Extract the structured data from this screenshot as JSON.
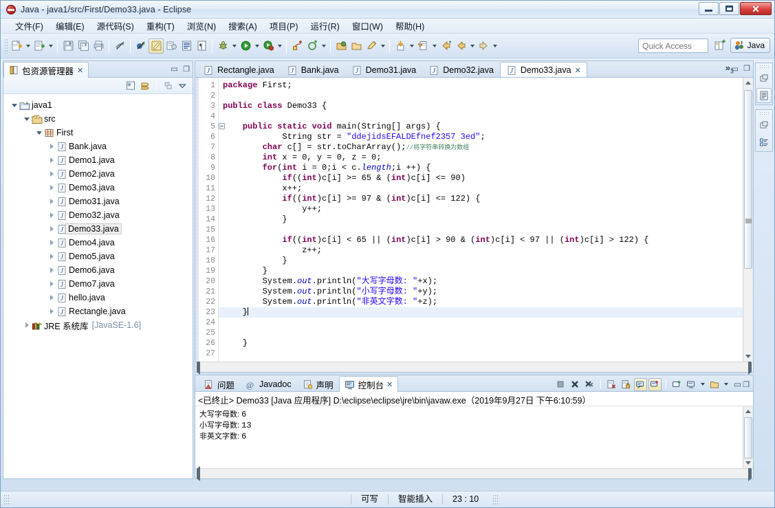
{
  "window": {
    "title": "Java  -  java1/src/First/Demo33.java  -  Eclipse",
    "minimize_label": "Minimize",
    "maximize_label": "Maximize",
    "close_label": "Close"
  },
  "menubar": [
    {
      "label": "文件(F)"
    },
    {
      "label": "编辑(E)"
    },
    {
      "label": "源代码(S)"
    },
    {
      "label": "重构(T)"
    },
    {
      "label": "浏览(N)"
    },
    {
      "label": "搜索(A)"
    },
    {
      "label": "项目(P)"
    },
    {
      "label": "运行(R)"
    },
    {
      "label": "窗口(W)"
    },
    {
      "label": "帮助(H)"
    }
  ],
  "toolbar": {
    "quick_access_placeholder": "Quick Access",
    "perspective_label": "Java",
    "icons": [
      "new-java-project-icon",
      "new-wizard-icon",
      "save-icon",
      "save-all-icon",
      "print-icon",
      "toggle-mark-occurrences-icon",
      "skip-breakpoints-icon",
      "new-java-class-icon",
      "open-type-icon",
      "external-tools-icon",
      "debug-icon",
      "run-icon",
      "run-last-tool-icon",
      "new-annotation-icon",
      "next-annotation-icon",
      "open-task-icon",
      "search-icon",
      "edit-icon",
      "last-edit-location-icon",
      "open-declaration-icon",
      "back-icon",
      "previous-edit-icon",
      "forward-icon"
    ]
  },
  "package_explorer": {
    "tab_label": "包资源管理器",
    "tab_icon": "package-explorer-icon",
    "close_glyph": "✕",
    "minimize_glyph": "▭",
    "maximize_glyph": "◻",
    "tools": [
      "collapse-all-icon",
      "link-with-editor-icon",
      "view-menu-filter-icon",
      "view-menu-icon"
    ],
    "tree": [
      {
        "label": "java1",
        "sub": "",
        "depth": 0,
        "icon": "project-folder-icon",
        "twist": "open",
        "selected": false
      },
      {
        "label": "src",
        "sub": "",
        "depth": 1,
        "icon": "source-folder-icon",
        "twist": "open",
        "selected": false
      },
      {
        "label": "First",
        "sub": "",
        "depth": 2,
        "icon": "package-icon",
        "twist": "open",
        "selected": false
      },
      {
        "label": "Bank.java",
        "sub": "",
        "depth": 3,
        "icon": "java-file-icon",
        "twist": "closed",
        "selected": false
      },
      {
        "label": "Demo1.java",
        "sub": "",
        "depth": 3,
        "icon": "java-file-icon",
        "twist": "closed",
        "selected": false
      },
      {
        "label": "Demo2.java",
        "sub": "",
        "depth": 3,
        "icon": "java-file-icon",
        "twist": "closed",
        "selected": false
      },
      {
        "label": "Demo3.java",
        "sub": "",
        "depth": 3,
        "icon": "java-file-icon",
        "twist": "closed",
        "selected": false
      },
      {
        "label": "Demo31.java",
        "sub": "",
        "depth": 3,
        "icon": "java-file-icon",
        "twist": "closed",
        "selected": false
      },
      {
        "label": "Demo32.java",
        "sub": "",
        "depth": 3,
        "icon": "java-file-icon",
        "twist": "closed",
        "selected": false
      },
      {
        "label": "Demo33.java",
        "sub": "",
        "depth": 3,
        "icon": "java-file-icon",
        "twist": "closed",
        "selected": true
      },
      {
        "label": "Demo4.java",
        "sub": "",
        "depth": 3,
        "icon": "java-file-icon",
        "twist": "closed",
        "selected": false
      },
      {
        "label": "Demo5.java",
        "sub": "",
        "depth": 3,
        "icon": "java-file-icon",
        "twist": "closed",
        "selected": false
      },
      {
        "label": "Demo6.java",
        "sub": "",
        "depth": 3,
        "icon": "java-file-icon",
        "twist": "closed",
        "selected": false
      },
      {
        "label": "Demo7.java",
        "sub": "",
        "depth": 3,
        "icon": "java-file-icon",
        "twist": "closed",
        "selected": false
      },
      {
        "label": "hello.java",
        "sub": "",
        "depth": 3,
        "icon": "java-file-icon",
        "twist": "closed",
        "selected": false
      },
      {
        "label": "Rectangle.java",
        "sub": "",
        "depth": 3,
        "icon": "java-file-icon",
        "twist": "closed",
        "selected": false
      },
      {
        "label": "JRE 系统库",
        "sub": "[JavaSE-1.6]",
        "depth": 1,
        "icon": "jre-library-icon",
        "twist": "closed",
        "selected": false
      }
    ]
  },
  "editor": {
    "tabs": [
      {
        "label": "Rectangle.java",
        "active": false
      },
      {
        "label": "Bank.java",
        "active": false
      },
      {
        "label": "Demo31.java",
        "active": false
      },
      {
        "label": "Demo32.java",
        "active": false
      },
      {
        "label": "Demo33.java",
        "active": true
      }
    ],
    "active_close_glyph": "✕",
    "overflow_label": "»",
    "overflow_count": "3",
    "minimize_glyph": "▭",
    "maximize_glyph": "◻",
    "first_line": 1,
    "total_lines": 27,
    "lines": [
      {
        "n": 1,
        "fold": false,
        "cur": false,
        "html": "<span class=\"kw\">package</span> First;"
      },
      {
        "n": 2,
        "fold": false,
        "cur": false,
        "html": ""
      },
      {
        "n": 3,
        "fold": false,
        "cur": false,
        "html": "<span class=\"kw\">public class</span> Demo33 {"
      },
      {
        "n": 4,
        "fold": false,
        "cur": false,
        "html": ""
      },
      {
        "n": 5,
        "fold": true,
        "cur": false,
        "html": "    <span class=\"kw\">public static void</span> main(String[] args) {"
      },
      {
        "n": 6,
        "fold": false,
        "cur": false,
        "html": "            String str = <span class=\"str\">\"ddejidsEFALDEfnef2357 3ed\"</span>;"
      },
      {
        "n": 7,
        "fold": false,
        "cur": false,
        "html": "        <span class=\"kw\">char</span> c[] = str.toCharArray();<span class=\"cmt\">//将字符串转换为数组</span>"
      },
      {
        "n": 8,
        "fold": false,
        "cur": false,
        "html": "        <span class=\"kw\">int</span> x = 0, y = 0, z = 0;"
      },
      {
        "n": 9,
        "fold": false,
        "cur": false,
        "html": "        <span class=\"kw\">for</span>(<span class=\"kw\">int</span> i = 0;i &lt; c.<span class=\"fld\">length</span>;i ++) {"
      },
      {
        "n": 10,
        "fold": false,
        "cur": false,
        "html": "            <span class=\"kw\">if</span>((<span class=\"kw\">int</span>)c[i] &gt;= 65 &amp; (<span class=\"kw\">int</span>)c[i] &lt;= 90)"
      },
      {
        "n": 11,
        "fold": false,
        "cur": false,
        "html": "            x++;"
      },
      {
        "n": 12,
        "fold": false,
        "cur": false,
        "html": "            <span class=\"kw\">if</span>((<span class=\"kw\">int</span>)c[i] &gt;= 97 &amp; (<span class=\"kw\">int</span>)c[i] &lt;= 122) {"
      },
      {
        "n": 13,
        "fold": false,
        "cur": false,
        "html": "                y++;"
      },
      {
        "n": 14,
        "fold": false,
        "cur": false,
        "html": "            }"
      },
      {
        "n": 15,
        "fold": false,
        "cur": false,
        "html": ""
      },
      {
        "n": 16,
        "fold": false,
        "cur": false,
        "html": "            <span class=\"kw\">if</span>((<span class=\"kw\">int</span>)c[i] &lt; 65 || (<span class=\"kw\">int</span>)c[i] &gt; 90 &amp; (<span class=\"kw\">int</span>)c[i] &lt; 97 || (<span class=\"kw\">int</span>)c[i] &gt; 122) {"
      },
      {
        "n": 17,
        "fold": false,
        "cur": false,
        "html": "                z++;"
      },
      {
        "n": 18,
        "fold": false,
        "cur": false,
        "html": "            }"
      },
      {
        "n": 19,
        "fold": false,
        "cur": false,
        "html": "        }"
      },
      {
        "n": 20,
        "fold": false,
        "cur": false,
        "html": "        System.<span class=\"fld\">out</span>.println(<span class=\"str\">\"大写字母数: \"</span>+x);"
      },
      {
        "n": 21,
        "fold": false,
        "cur": false,
        "html": "        System.<span class=\"fld\">out</span>.println(<span class=\"str\">\"小写字母数: \"</span>+y);"
      },
      {
        "n": 22,
        "fold": false,
        "cur": false,
        "html": "        System.<span class=\"fld\">out</span>.println(<span class=\"str\">\"非英文字数: \"</span>+z);"
      },
      {
        "n": 23,
        "fold": false,
        "cur": true,
        "html": "    }"
      },
      {
        "n": 24,
        "fold": false,
        "cur": false,
        "html": ""
      },
      {
        "n": 25,
        "fold": false,
        "cur": false,
        "html": ""
      },
      {
        "n": 26,
        "fold": false,
        "cur": false,
        "html": "    }"
      },
      {
        "n": 27,
        "fold": false,
        "cur": false,
        "html": ""
      }
    ]
  },
  "console": {
    "tabs": [
      {
        "label": "问题",
        "icon": "problems-icon",
        "active": false
      },
      {
        "label": "Javadoc",
        "icon": "javadoc-icon",
        "active": false
      },
      {
        "label": "声明",
        "icon": "declaration-icon",
        "active": false
      },
      {
        "label": "控制台",
        "icon": "console-icon",
        "active": true
      }
    ],
    "close_glyph": "✕",
    "minimize_glyph": "▭",
    "maximize_glyph": "◻",
    "tools": [
      "terminate-icon",
      "remove-launch-icon",
      "remove-all-launches-icon",
      "clear-console-icon",
      "scroll-lock-icon",
      "show-console-on-output-icon",
      "pin-console-icon",
      "new-console-view-icon",
      "display-selected-console-icon",
      "open-console-icon"
    ],
    "launch_info": "<已终止> Demo33 [Java 应用程序] D:\\eclipse\\eclipse\\jre\\bin\\javaw.exe（2019年9月27日 下午6:10:59）",
    "output": [
      {
        "label": "大写字母数:",
        "value": "6"
      },
      {
        "label": "小写字母数:",
        "value": "13"
      },
      {
        "label": "非英文字数:",
        "value": "6"
      }
    ]
  },
  "right_strip": {
    "groups": [
      {
        "buttons": [
          {
            "icon": "restore-icon",
            "selected": false
          },
          {
            "icon": "outline-view-icon",
            "selected": true
          }
        ]
      },
      {
        "buttons": [
          {
            "icon": "restore-icon",
            "selected": false
          },
          {
            "icon": "task-list-view-icon",
            "selected": false
          }
        ]
      }
    ]
  },
  "statusbar": {
    "writable": "可写",
    "insert_mode": "智能插入",
    "cursor_position": "23 : 10"
  },
  "colors": {
    "keyword": "#7f0055",
    "string": "#2a00ff",
    "comment": "#3f7f5f",
    "field": "#0000c0",
    "current_line": "#e8f1fb",
    "chrome": "#d4e2f1",
    "close_button": "#d7413c"
  }
}
